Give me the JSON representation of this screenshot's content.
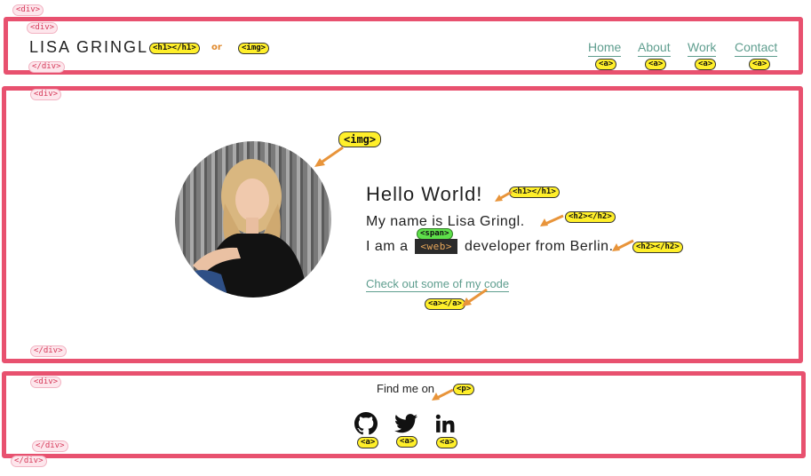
{
  "header": {
    "logo_text": "LISA GRINGL",
    "nav": [
      "Home",
      "About",
      "Work",
      "Contact"
    ],
    "or_label": "or"
  },
  "hero": {
    "title": "Hello World!",
    "name_line": "My name is Lisa Gringl.",
    "role_prefix": "I am a",
    "role_badge": "<web>",
    "role_suffix": "developer from Berlin.",
    "cta": "Check out some of my code"
  },
  "footer": {
    "find_text": "Find me on",
    "socials": [
      "github-icon",
      "twitter-icon",
      "linkedin-icon"
    ]
  },
  "annotations": {
    "div_open": "<div>",
    "div_close": "</div>",
    "h1": "<h1></h1>",
    "img": "<img>",
    "a": "<a>",
    "a_pair": "<a></a>",
    "h2": "<h2></h2>",
    "span": "<span>",
    "p": "<p>"
  },
  "colors": {
    "accent": "#5f9e8f",
    "box": "#e8516f",
    "tag_yellow": "#ffef2a",
    "arrow": "#e8943a"
  }
}
